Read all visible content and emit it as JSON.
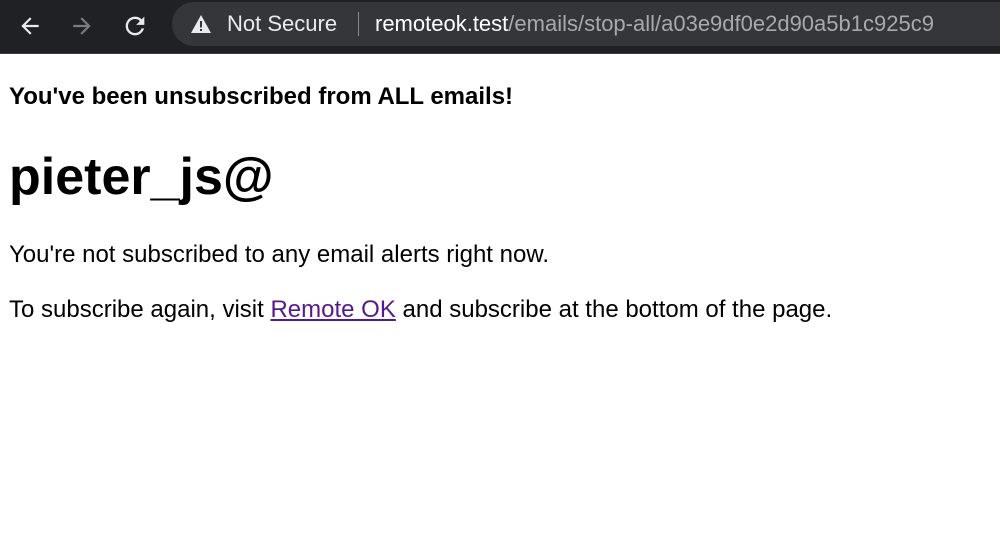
{
  "browser": {
    "back_icon": "arrow-left-icon",
    "forward_icon": "arrow-right-icon",
    "reload_icon": "reload-icon",
    "security_icon": "warning-triangle-icon",
    "security_label": "Not Secure",
    "url_host": "remoteok.test",
    "url_path": "/emails/stop-all/a03e9df0e2d90a5b1c925c9",
    "colors": {
      "toolbar_bg": "#202124",
      "omnibox_bg": "#35363a",
      "url_host": "#ffffff",
      "url_path": "#a8a9ac"
    }
  },
  "page": {
    "notice": "You've been unsubscribed from ALL emails!",
    "username": "pieter_js@",
    "status_text": "You're not subscribed to any email alerts right now.",
    "resubscribe_prefix": "To subscribe again, visit ",
    "resubscribe_link": "Remote OK",
    "resubscribe_suffix": " and subscribe at the bottom of the page.",
    "colors": {
      "text": "#000000",
      "visited_link": "#551a8b"
    }
  }
}
